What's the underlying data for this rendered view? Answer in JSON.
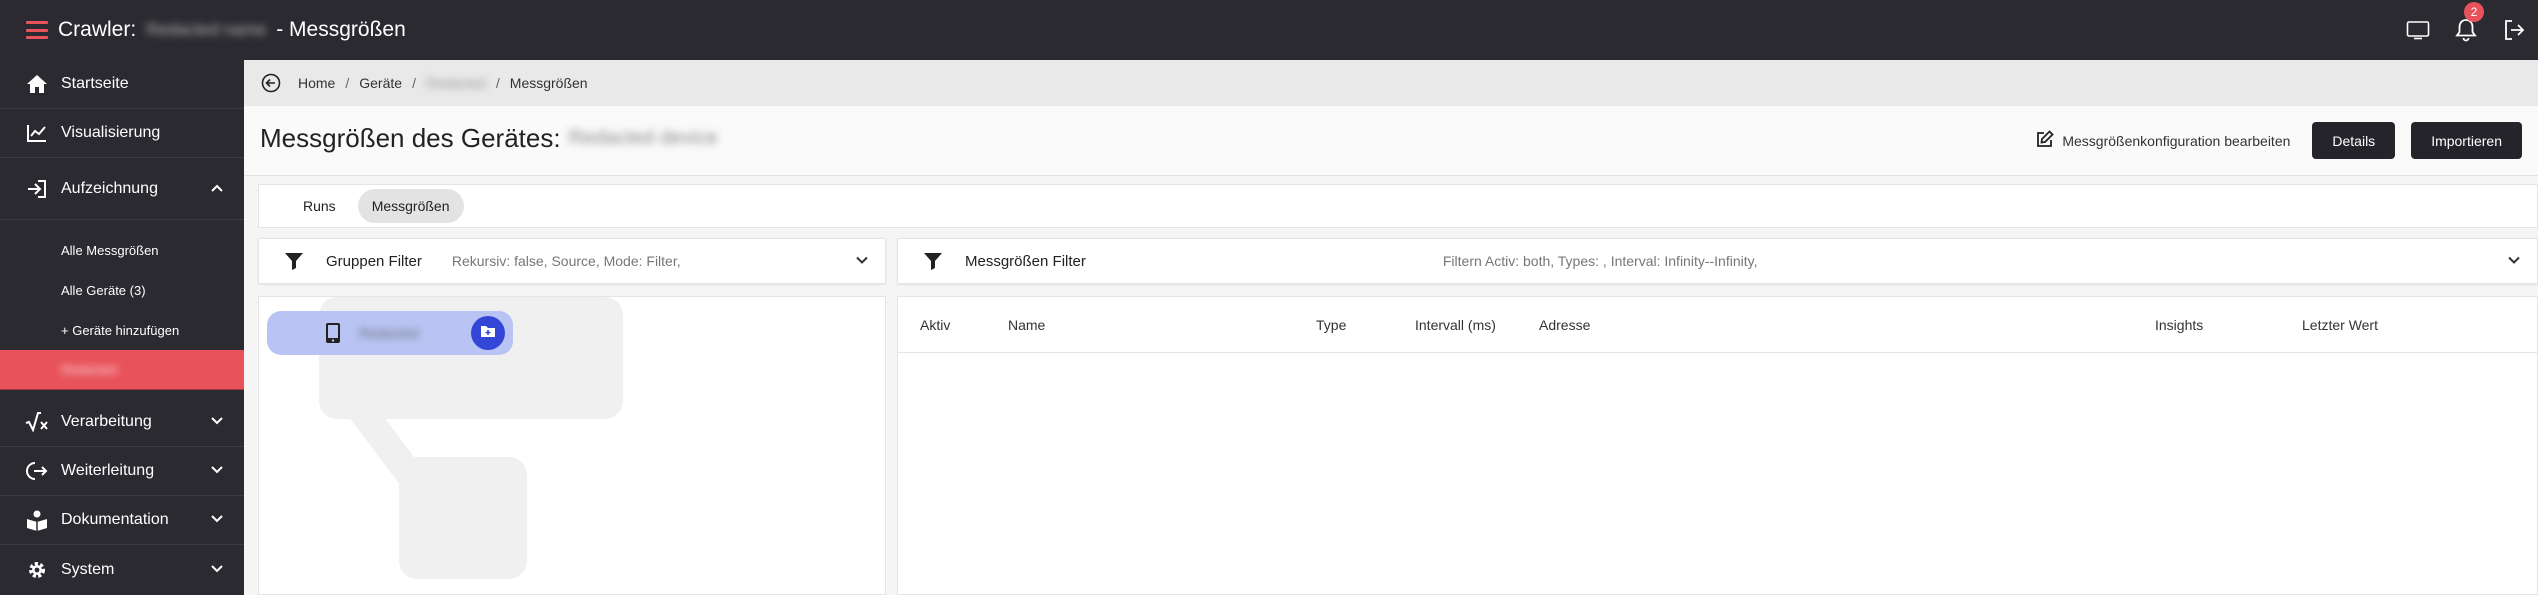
{
  "topbar": {
    "app_name": "Crawler:",
    "instance_name": "Redacted name",
    "section": "- Messgrößen",
    "notification_count": "2",
    "icons": [
      "menu-icon",
      "monitor-icon",
      "bell-icon",
      "logout-icon"
    ]
  },
  "sidebar": {
    "items": [
      {
        "label": "Startseite",
        "icon": "home-icon"
      },
      {
        "label": "Visualisierung",
        "icon": "chart-line-icon"
      },
      {
        "label": "Aufzeichnung",
        "icon": "login-arrow-icon"
      },
      {
        "label": "Verarbeitung",
        "icon": "sqrt-icon"
      },
      {
        "label": "Weiterleitung",
        "icon": "forward-icon"
      },
      {
        "label": "Dokumentation",
        "icon": "book-icon"
      },
      {
        "label": "System",
        "icon": "gear-icon"
      }
    ],
    "sub_items": [
      {
        "label": "Alle Messgrößen"
      },
      {
        "label": "Alle Geräte (3)"
      },
      {
        "label": "+ Geräte hinzufügen"
      },
      {
        "label": "Redacted"
      }
    ]
  },
  "breadcrumb": {
    "items": [
      "Home",
      "Geräte",
      "Redacted",
      "Messgrößen"
    ],
    "separator": "/"
  },
  "header": {
    "title": "Messgrößen des Gerätes:",
    "device_name": "Redacted device",
    "edit_label": "Messgrößenkonfiguration bearbeiten",
    "details_label": "Details",
    "import_label": "Importieren"
  },
  "tabs": [
    {
      "label": "Runs",
      "active": false
    },
    {
      "label": "Messgrößen",
      "active": true
    }
  ],
  "group_filter": {
    "label": "Gruppen Filter",
    "summary": "Rekursiv: false, Source, Mode: Filter,"
  },
  "measure_filter": {
    "label": "Messgrößen Filter",
    "summary": "Filtern Activ: both, Types: , Interval: Infinity--Infinity,"
  },
  "tree": {
    "node_label": "Redacted"
  },
  "table": {
    "columns": [
      "Aktiv",
      "Name",
      "Type",
      "Intervall (ms)",
      "Adresse",
      "Insights",
      "Letzter Wert"
    ],
    "rows": []
  },
  "colors": {
    "accent": "#e8525a",
    "dark": "#2b2a30",
    "node": "#b9c4f4",
    "fab": "#3346d6"
  }
}
